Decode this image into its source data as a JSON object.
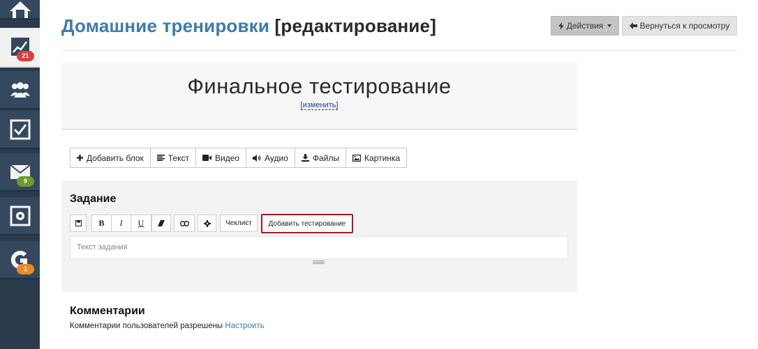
{
  "sidebar": {
    "items": [
      {
        "icon": "home-icon",
        "badge": ""
      },
      {
        "icon": "chart-icon",
        "badge": "21",
        "badge_color": "#d9403a",
        "active": true
      },
      {
        "icon": "users-icon",
        "badge": ""
      },
      {
        "icon": "checkbox-icon",
        "badge": ""
      },
      {
        "icon": "mail-icon",
        "badge": "9",
        "badge_color": "#6e9a2e"
      },
      {
        "icon": "settings-panel-icon",
        "badge": ""
      },
      {
        "icon": "getcourse-logo-icon",
        "badge": "1",
        "badge_color": "#eb8a26"
      }
    ]
  },
  "header": {
    "title_main": "Домашние тренировки",
    "title_suffix": "[редактирование]",
    "actions_label": "Действия",
    "back_label": "Вернуться к просмотру"
  },
  "lesson": {
    "title": "Финальное тестирование",
    "change_link": "[изменить]"
  },
  "block_toolbar": {
    "add_block": "Добавить блок",
    "text": "Текст",
    "video": "Видео",
    "audio": "Аудио",
    "files": "Файлы",
    "image": "Картинка"
  },
  "task": {
    "heading": "Задание",
    "checklist_label": "Чеклист",
    "add_test_label": "Добавить тестирование",
    "placeholder": "Текст задания",
    "bold": "B",
    "italic": "I",
    "underline": "U"
  },
  "comments": {
    "heading": "Комментарии",
    "status": "Комментарии пользователей разрешены",
    "configure_link": "Настроить"
  },
  "colors": {
    "sidebar_bg": "#34495e",
    "title_blue": "#3c7cad",
    "highlight_red": "#a01c1c"
  }
}
